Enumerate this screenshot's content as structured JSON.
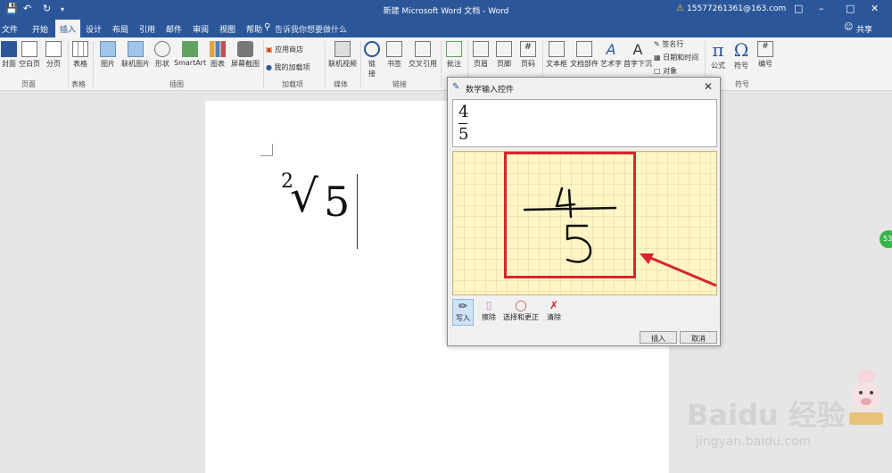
{
  "titlebar": {
    "document_title": "新建 Microsoft Word 文档 - Word",
    "account": "15577261361@163.com",
    "account_warning_icon": "warning-icon",
    "quick_access": [
      "save-icon",
      "undo-icon",
      "redo-icon",
      "customize-icon"
    ]
  },
  "tabs": {
    "items": [
      {
        "label": "文件"
      },
      {
        "label": "开始"
      },
      {
        "label": "插入"
      },
      {
        "label": "设计"
      },
      {
        "label": "布局"
      },
      {
        "label": "引用"
      },
      {
        "label": "邮件"
      },
      {
        "label": "审阅"
      },
      {
        "label": "视图"
      },
      {
        "label": "帮助"
      }
    ],
    "active": "插入",
    "tellme": "告诉我你想要做什么",
    "share": "共享"
  },
  "ribbon": {
    "buttons": {
      "cover": "封面",
      "blank_page": "空白页",
      "page_break": "分页",
      "table": "表格",
      "picture": "图片",
      "online_picture": "联机图片",
      "shapes": "形状",
      "smartart": "SmartArt",
      "chart": "图表",
      "screenshot": "屏幕截图",
      "store": "应用商店",
      "my_addins": "我的加载项",
      "online_video": "联机视频",
      "link": "链",
      "link2": "接",
      "bookmark": "书签",
      "cross_ref": "交叉引用",
      "comment": "批注",
      "header": "页眉",
      "footer": "页脚",
      "page_number": "页码",
      "textbox": "文本框",
      "quick_parts": "文档部件",
      "wordart": "艺术字",
      "dropcap": "首字下沉",
      "signature": "签名行",
      "datetime": "日期和时间",
      "object": "对象",
      "equation": "公式",
      "symbol": "符号",
      "number": "编号"
    },
    "groups": {
      "pages": "页面",
      "tables": "表格",
      "illustrations": "插图",
      "addins": "加载项",
      "media": "媒体",
      "links": "链接",
      "symbols": "符号"
    }
  },
  "document": {
    "equation": {
      "index": "2",
      "radicand": "5"
    }
  },
  "math_input": {
    "title": "数学输入控件",
    "preview": {
      "numerator": "4",
      "denominator": "5"
    },
    "handwriting": {
      "numerator": "4",
      "denominator": "5"
    },
    "tools": {
      "write": "写入",
      "erase": "擦除",
      "select_correct": "选择和更正",
      "clear": "清除"
    },
    "insert": "插入",
    "cancel": "取消"
  },
  "watermark": {
    "brand": "Baidu 经验",
    "url": "jingyan.baidu.com",
    "side_badge": "53"
  },
  "colors": {
    "word_blue": "#2b579a",
    "annotation_red": "#d9252a",
    "canvas_yellow": "#fff5c6"
  }
}
